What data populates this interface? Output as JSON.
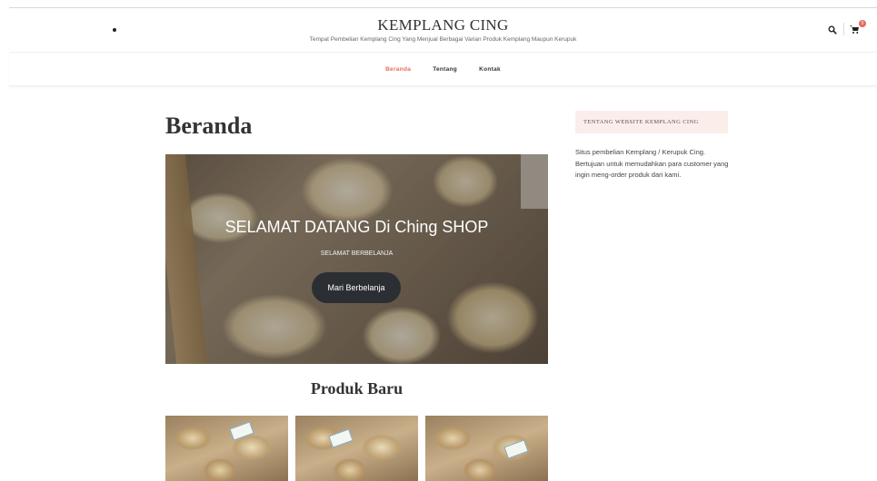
{
  "header": {
    "site_title": "KEMPLANG CING",
    "tagline": "Tempat Pembelian Kemplang Cing Yang Menjual Berbagai Varian Produk Kemplang Maupun Kerupuk",
    "cart_count": "0"
  },
  "nav": {
    "items": [
      {
        "label": "Beranda",
        "active": true
      },
      {
        "label": "Tentang",
        "active": false
      },
      {
        "label": "Kontak",
        "active": false
      }
    ]
  },
  "main": {
    "page_title": "Beranda",
    "hero": {
      "title": "SELAMAT DATANG Di Ching SHOP",
      "subtitle": "SELAMAT BERBELANJA",
      "button_label": "Mari Berbelanja"
    },
    "section_title": "Produk Baru"
  },
  "sidebar": {
    "widget_title": "TENTANG WEBSITE KEMPLANG CING",
    "widget_text": "Situs pembelian Kemplang / Kerupuk Cing. Bertujuan untuk memudahkan para customer yang ingin meng-order produk dari kami."
  },
  "colors": {
    "accent": "#e86a5a",
    "button_dark": "#2b2e33",
    "widget_bg": "#fbeeea"
  },
  "icons": [
    "search-icon",
    "cart-icon"
  ]
}
